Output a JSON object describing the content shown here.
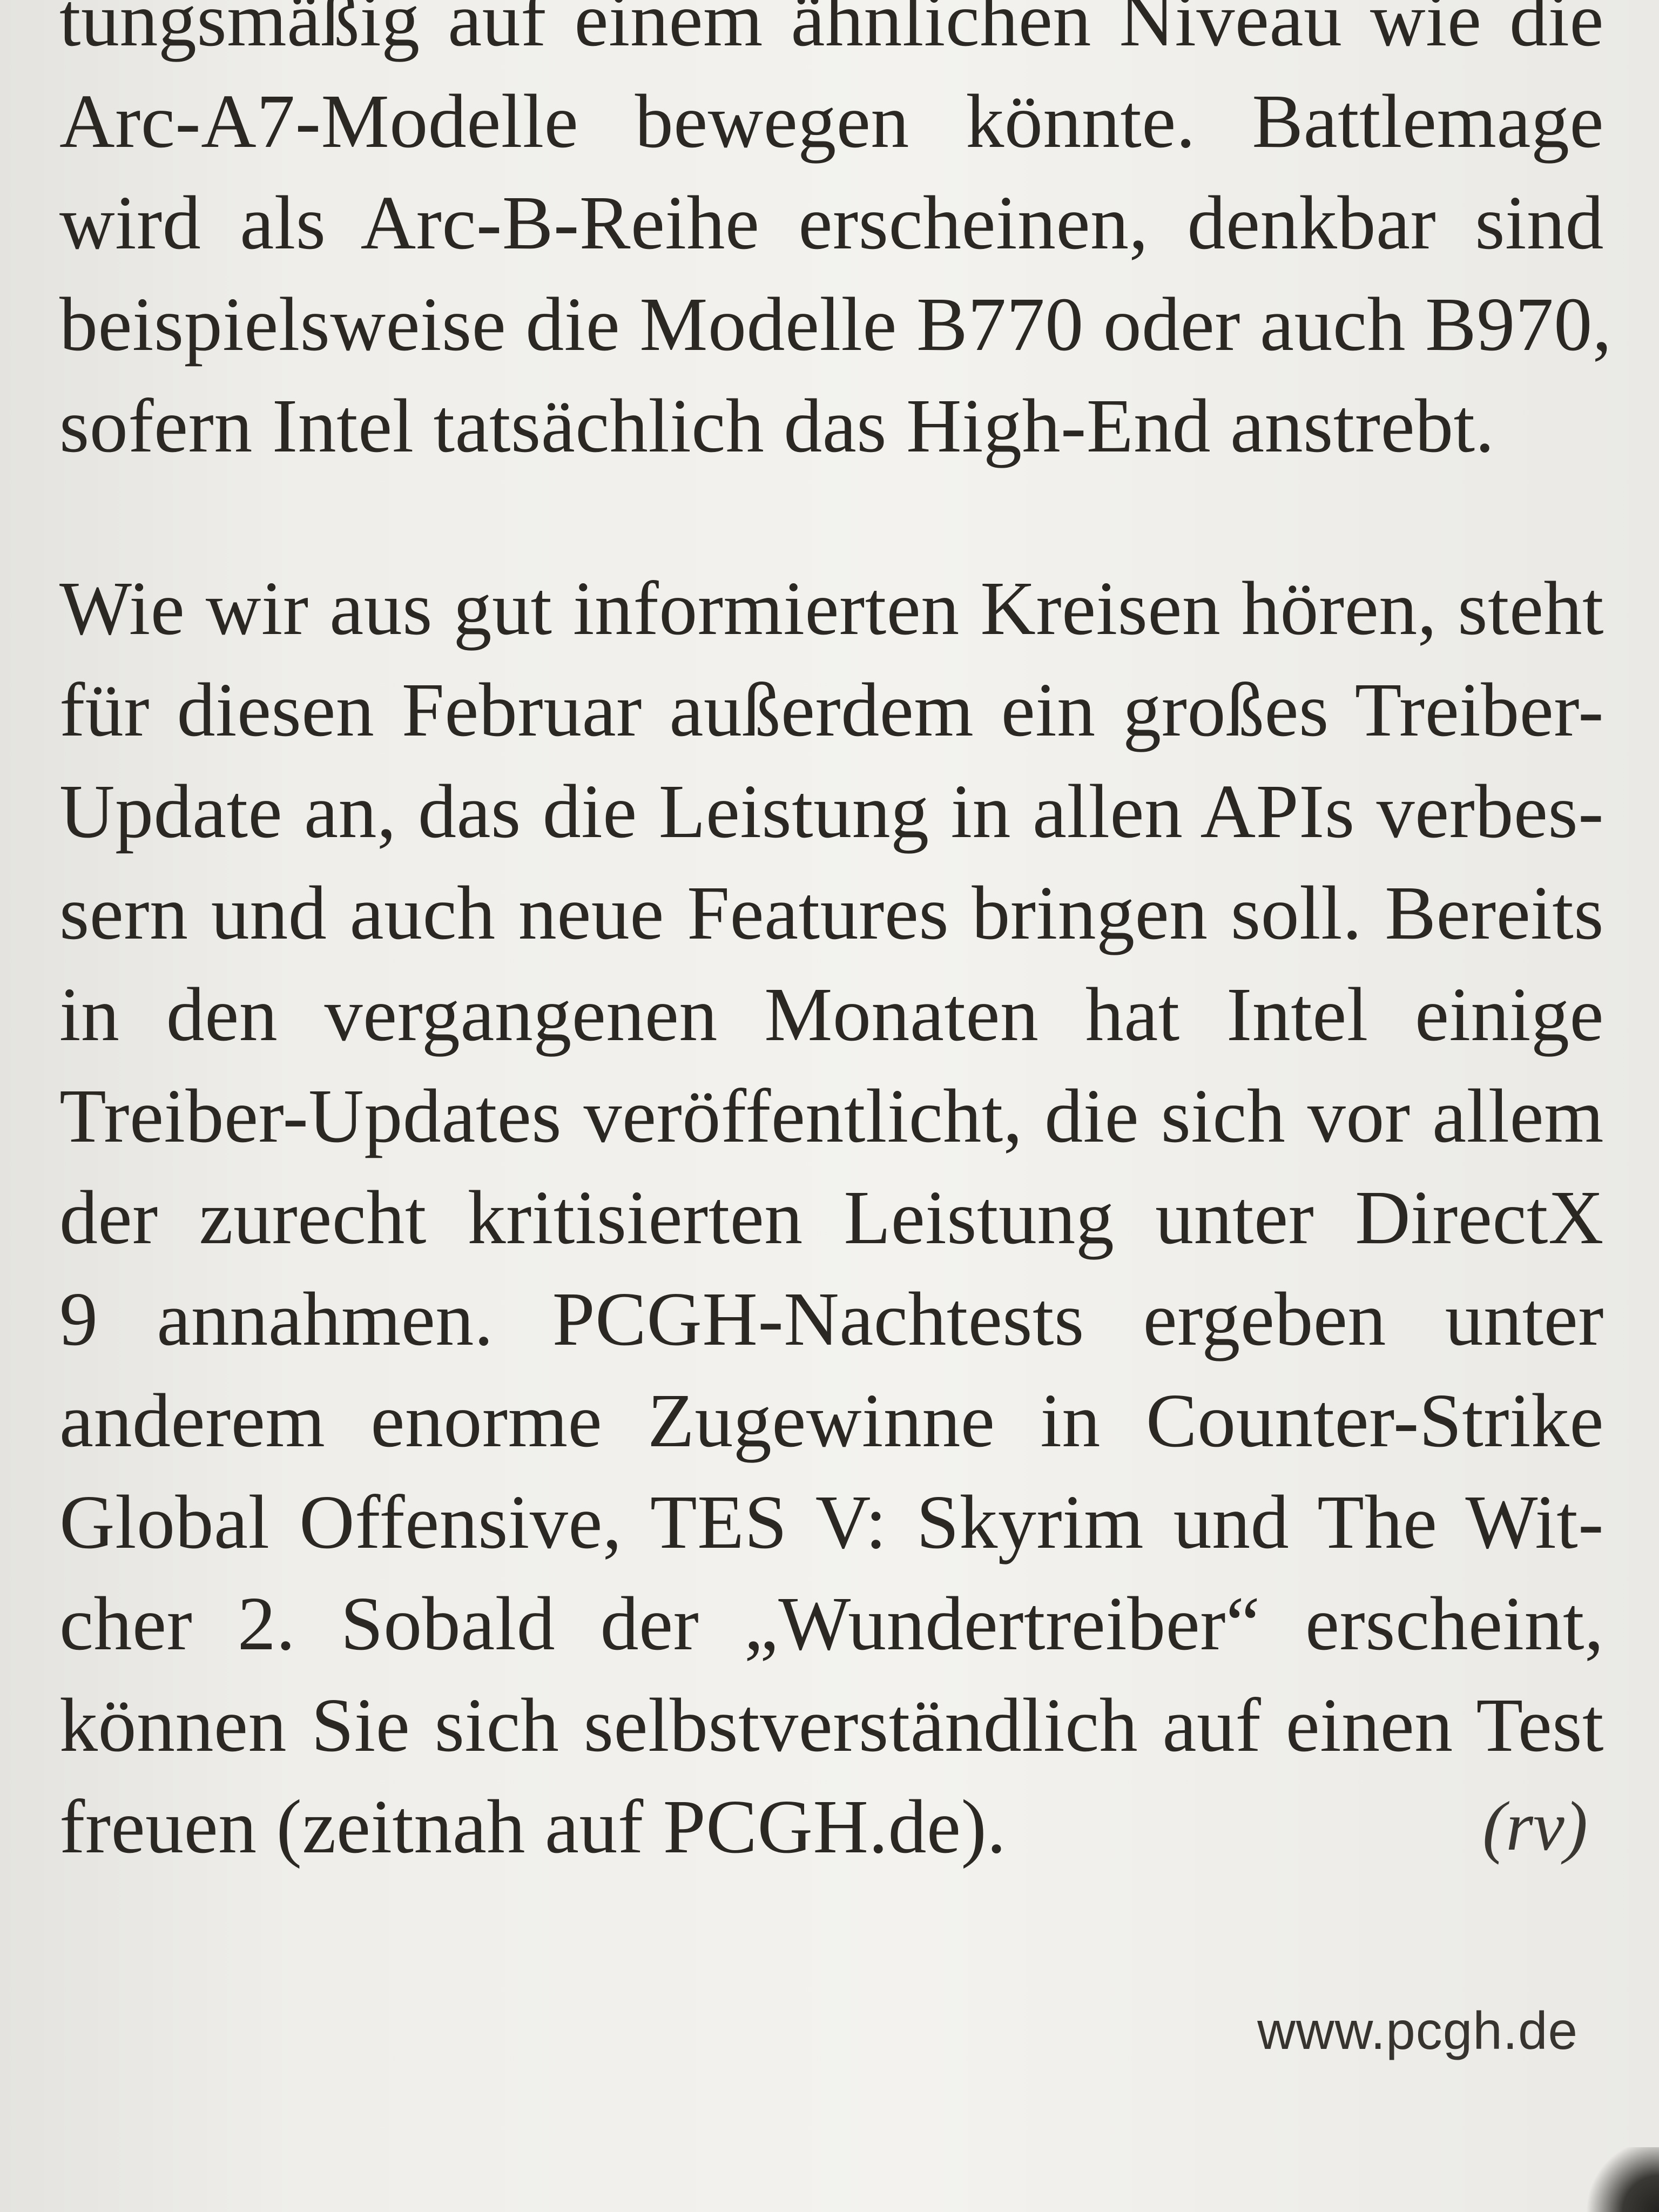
{
  "article": {
    "paragraph_1_lines": [
      "tungsmäßig auf einem ähnlichen Niveau wie die",
      "Arc-A7-Modelle bewegen könnte. Battlemage",
      "wird als Arc-B-Reihe erscheinen, denkbar sind",
      "beispielsweise die Modelle B770 oder auch B970,",
      "sofern Intel tatsächlich das High-End anstrebt."
    ],
    "paragraph_2_lines": [
      "Wie wir aus gut informierten Kreisen hören, steht",
      "für diesen Februar außerdem ein großes Treiber-",
      "Update an, das die Leistung in allen APIs verbes-",
      "sern und auch neue Features bringen soll. Bereits",
      "in den vergangenen Monaten hat Intel einige",
      "Treiber-Updates veröffentlicht, die sich vor allem",
      "der zurecht kritisierten Leistung unter DirectX",
      "9 annahmen. PCGH-Nachtests ergeben unter",
      "anderem enorme Zugewinne in Counter-Strike",
      "Global Offensive, TES V: Skyrim und The Wit-",
      "cher 2. Sobald der „Wundertreiber“ erscheint,",
      "können Sie sich selbstverständlich auf einen Test",
      "freuen (zeitnah auf PCGH.de)."
    ],
    "author_tag": "(rv)"
  },
  "footer": {
    "url": "www.pcgh.de"
  }
}
